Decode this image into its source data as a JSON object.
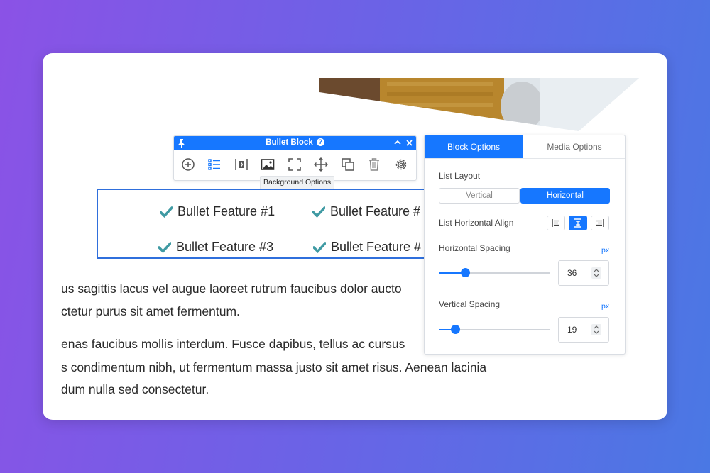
{
  "toolbar": {
    "title": "Bullet Block",
    "help_glyph": "?",
    "tooltip": "Background Options",
    "icons": [
      "add-icon",
      "list-icon",
      "spacing-icon",
      "image-icon",
      "fullscreen-icon",
      "move-icon",
      "duplicate-icon",
      "trash-icon",
      "gear-icon"
    ]
  },
  "bullets": [
    "Bullet Feature #1",
    "Bullet Feature #",
    "Bullet Feature #3",
    "Bullet Feature #"
  ],
  "paragraphs": [
    "us sagittis lacus vel augue laoreet rutrum faucibus dolor aucto",
    "ctetur purus sit amet fermentum.",
    "enas faucibus mollis interdum. Fusce dapibus, tellus ac cursus",
    "s condimentum nibh, ut fermentum massa justo sit amet risus. Aenean lacinia",
    "dum nulla sed consectetur."
  ],
  "panel": {
    "tabs": [
      "Block Options",
      "Media Options"
    ],
    "list_layout_label": "List Layout",
    "layout_options": [
      "Vertical",
      "Horizontal"
    ],
    "selected_layout": "Horizontal",
    "align_label": "List Horizontal Align",
    "align_options": [
      "align-left-icon",
      "align-center-icon",
      "align-right-icon"
    ],
    "selected_align": "center",
    "h_spacing_label": "Horizontal Spacing",
    "h_spacing_unit": "px",
    "h_spacing_value": "36",
    "h_spacing_fraction": 0.24,
    "v_spacing_label": "Vertical Spacing",
    "v_spacing_unit": "px",
    "v_spacing_value": "19",
    "v_spacing_fraction": 0.15
  },
  "colors": {
    "accent": "#1677ff",
    "check": "#3f9aa3"
  }
}
